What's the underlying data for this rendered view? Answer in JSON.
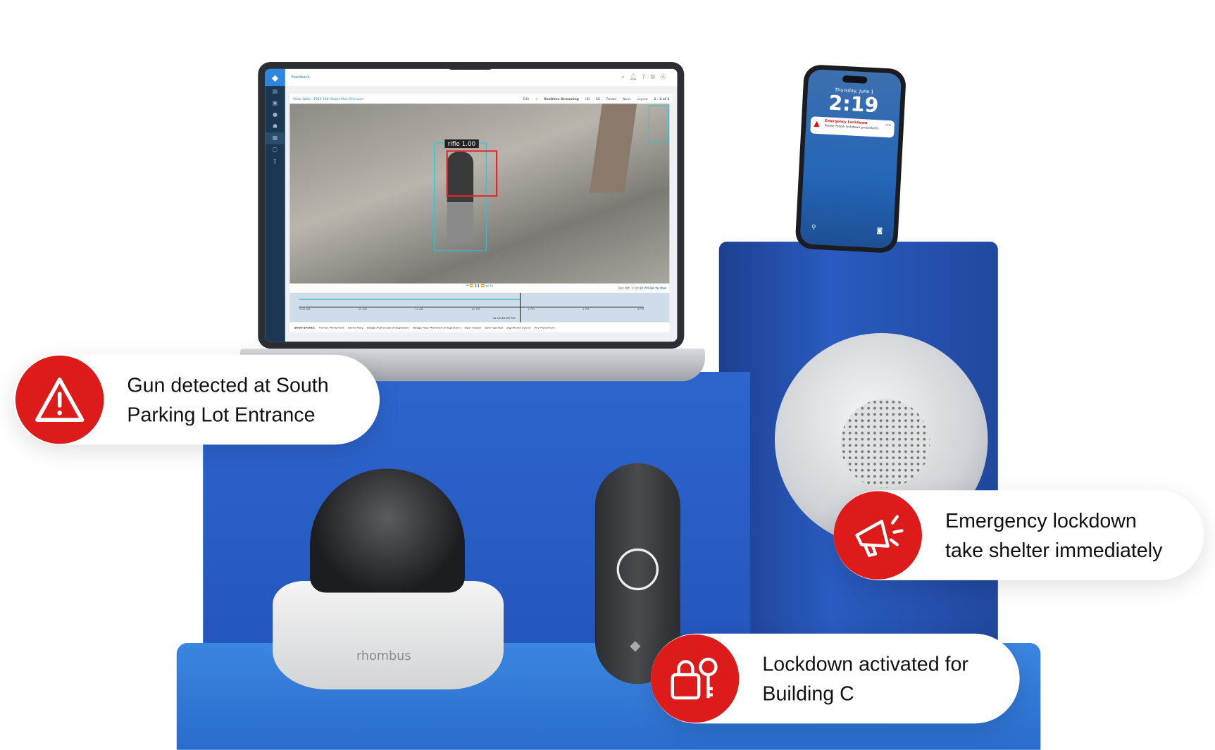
{
  "laptop": {
    "topbar": {
      "link": "Feedback"
    },
    "toolbar": {
      "breadcrumb": "Video Walls : 1919 19th Street Main Entrance",
      "edit": "Edit",
      "realtime": "Realtime Streaming",
      "hd": "HD",
      "sd": "SD",
      "rotate_label": "Rotate",
      "rotate_value": "None",
      "layout_label": "Layout",
      "pager": "1 - 3 of 3"
    },
    "detection_label": "rifle 1.00",
    "controls": {
      "speed": "1x",
      "date": "Dec 6th",
      "time": "1:16:48 PM",
      "go_live": "Go to live"
    },
    "timeline": {
      "ticks": [
        "9:00 AM",
        "10 AM",
        "11 AM",
        "12 PM",
        "1 PM",
        "2 PM",
        "3 PM"
      ],
      "cursor": "01:16:48 PM PST"
    },
    "legend": {
      "title": "Show Events:",
      "items": [
        "Human Movement",
        "Saved Face",
        "Badge Authorized (Integration)",
        "Badge-Face Mismatch (Integration)",
        "Door Closed",
        "Door Opened",
        "Significant Sound",
        "Any Movement"
      ]
    }
  },
  "phone": {
    "date": "Thursday, June 1",
    "time": "2:19",
    "notification": {
      "title": "Emergency Lockdown",
      "body": "Please follow lockdown procedures.",
      "age": "now"
    }
  },
  "camera_brand": "rhombus",
  "callouts": [
    {
      "icon": "warning-icon",
      "text_line1": "Gun detected at South",
      "text_line2": "Parking Lot Entrance"
    },
    {
      "icon": "megaphone-icon",
      "text_line1": "Emergency lockdown",
      "text_line2": "take shelter immediately"
    },
    {
      "icon": "lock-key-icon",
      "text_line1": "Lockdown activated for",
      "text_line2": "Building C"
    }
  ],
  "colors": {
    "alert_red": "#de1b1b",
    "pedestal_blue": "#2459c1",
    "accent": "#2f86e0"
  }
}
